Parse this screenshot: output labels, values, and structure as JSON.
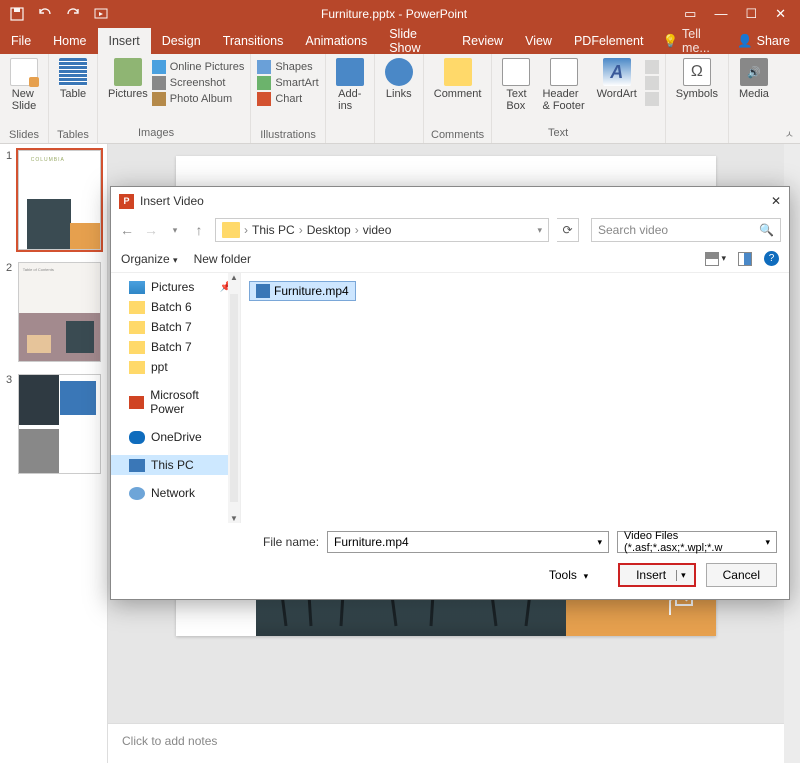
{
  "titlebar": {
    "title": "Furniture.pptx - PowerPoint"
  },
  "menu": {
    "tabs": [
      "File",
      "Home",
      "Insert",
      "Design",
      "Transitions",
      "Animations",
      "Slide Show",
      "Review",
      "View",
      "PDFelement"
    ],
    "active_index": 2,
    "tell_me": "Tell me...",
    "share": "Share"
  },
  "ribbon": {
    "slides": {
      "new_slide": "New\nSlide",
      "group": "Slides"
    },
    "tables": {
      "table": "Table",
      "group": "Tables"
    },
    "images": {
      "pictures": "Pictures",
      "online": "Online Pictures",
      "screenshot": "Screenshot",
      "album": "Photo Album",
      "group": "Images"
    },
    "illustrations": {
      "shapes": "Shapes",
      "smartart": "SmartArt",
      "chart": "Chart",
      "group": "Illustrations"
    },
    "addins": {
      "label": "Add-\nins",
      "group": ""
    },
    "links": {
      "label": "Links",
      "group": ""
    },
    "comment": {
      "label": "Comment",
      "group": "Comments"
    },
    "text": {
      "textbox": "Text\nBox",
      "header": "Header\n& Footer",
      "wordart": "WordArt",
      "group": "Text"
    },
    "symbols": {
      "label": "Symbols",
      "group": ""
    },
    "media": {
      "label": "Media",
      "group": ""
    }
  },
  "slides": {
    "count": 3,
    "active": 1,
    "nums": [
      "1",
      "2",
      "3"
    ]
  },
  "notes_placeholder": "Click to add notes",
  "dialog": {
    "title": "Insert Video",
    "crumbs": [
      "This PC",
      "Desktop",
      "video"
    ],
    "search_placeholder": "Search video",
    "organize": "Organize",
    "new_folder": "New folder",
    "sidebar": [
      {
        "label": "Pictures",
        "type": "pictures",
        "pinned": true
      },
      {
        "label": "Batch 6",
        "type": "folder"
      },
      {
        "label": "Batch 7",
        "type": "folder"
      },
      {
        "label": "Batch 7",
        "type": "folder"
      },
      {
        "label": "ppt",
        "type": "folder"
      },
      {
        "label": "Microsoft Power",
        "type": "pp"
      },
      {
        "label": "OneDrive",
        "type": "cloud"
      },
      {
        "label": "This PC",
        "type": "pc",
        "selected": true
      },
      {
        "label": "Network",
        "type": "net"
      }
    ],
    "file_selected": "Furniture.mp4",
    "file_name_label": "File name:",
    "file_name_value": "Furniture.mp4",
    "filter": "Video Files (*.asf;*.asx;*.wpl;*.w",
    "tools": "Tools",
    "insert": "Insert",
    "cancel": "Cancel"
  }
}
